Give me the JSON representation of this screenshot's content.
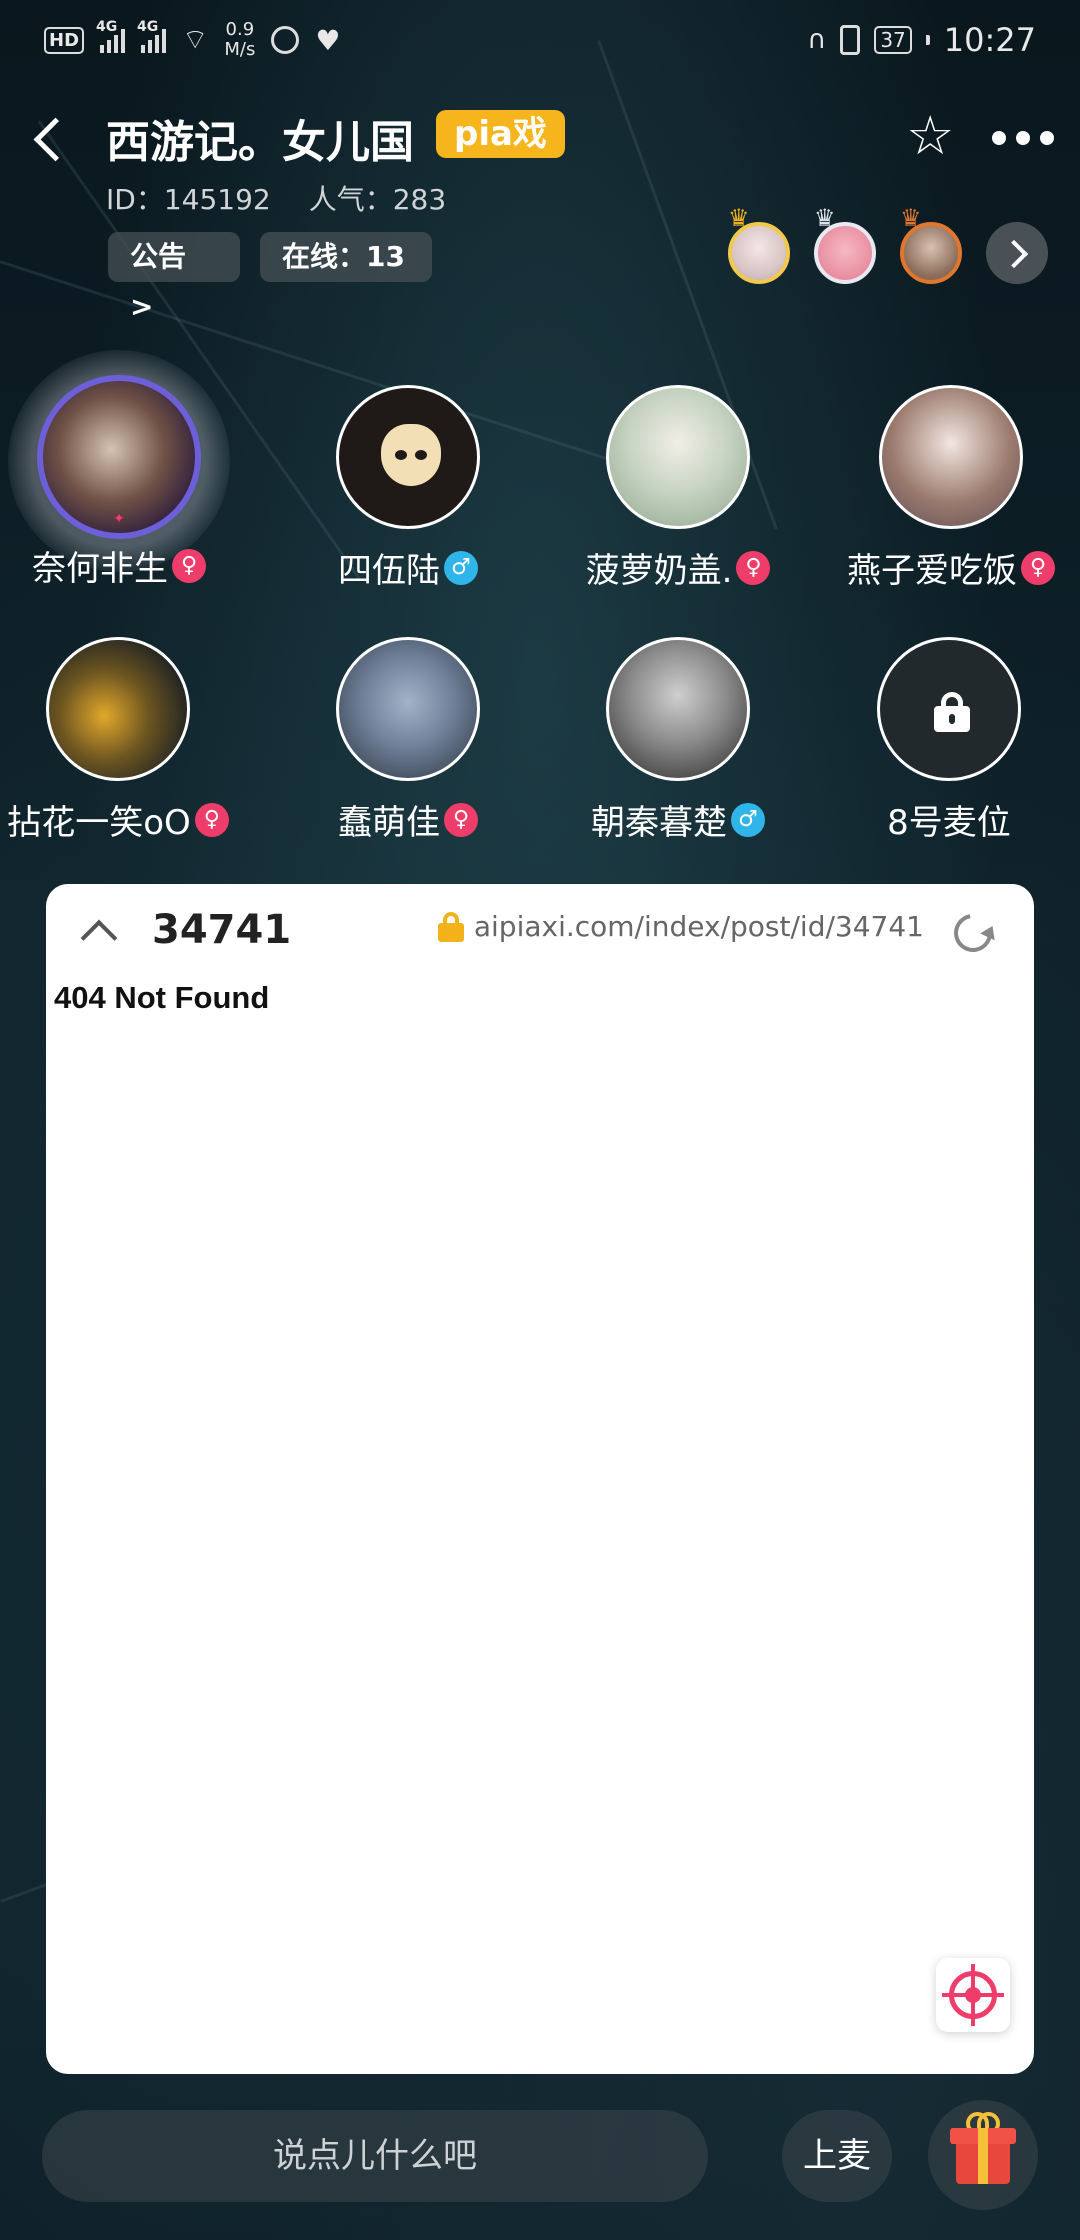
{
  "status_bar": {
    "hd_label": "HD",
    "network_1": "4G",
    "network_2": "4G",
    "speed_value": "0.9",
    "speed_unit": "M/s",
    "battery": "37",
    "time": "10:27",
    "icons": [
      "hd-icon",
      "signal-icon",
      "wifi-icon",
      "app-notification-icon",
      "heart-rate-icon",
      "headphones-icon",
      "vibrate-icon",
      "battery-icon"
    ]
  },
  "header": {
    "title": "西游记。女儿国",
    "badge": "pia戏",
    "id_label": "ID：145192",
    "popularity_label": "人气：283",
    "notice_label": "公告 >",
    "online_label": "在线：13"
  },
  "seats": [
    {
      "name": "奈何非生",
      "gender": "female",
      "gender_symbol": "♀",
      "avatar": "host-avatar"
    },
    {
      "name": "四伍陆",
      "gender": "male",
      "gender_symbol": "♂",
      "avatar": "mask-avatar"
    },
    {
      "name": "菠萝奶盖.",
      "gender": "female",
      "gender_symbol": "♀",
      "avatar": "anime-boy-avatar"
    },
    {
      "name": "燕子爱吃饭",
      "gender": "female",
      "gender_symbol": "♀",
      "avatar": "anime-girl-avatar"
    },
    {
      "name": "拈花一笑oO",
      "gender": "female",
      "gender_symbol": "♀",
      "avatar": "bird-claw-avatar"
    },
    {
      "name": "蠢萌佳",
      "gender": "female",
      "gender_symbol": "♀",
      "avatar": "cartoon-mouse-avatar"
    },
    {
      "name": "朝秦暮楚",
      "gender": "male",
      "gender_symbol": "♂",
      "avatar": "ink-figure-avatar"
    },
    {
      "name": "8号麦位",
      "gender": "",
      "gender_symbol": "",
      "avatar": "locked-seat"
    }
  ],
  "webview": {
    "post_id": "34741",
    "url": "aipiaxi.com/index/post/id/34741",
    "body_text": "404 Not Found"
  },
  "bottom": {
    "chat_placeholder": "说点儿什么吧",
    "mic_label": "上麦"
  },
  "colors": {
    "badge": "#f6b51d",
    "female": "#ee3d6a",
    "male": "#2fb5ea",
    "panel": "#ffffff"
  }
}
